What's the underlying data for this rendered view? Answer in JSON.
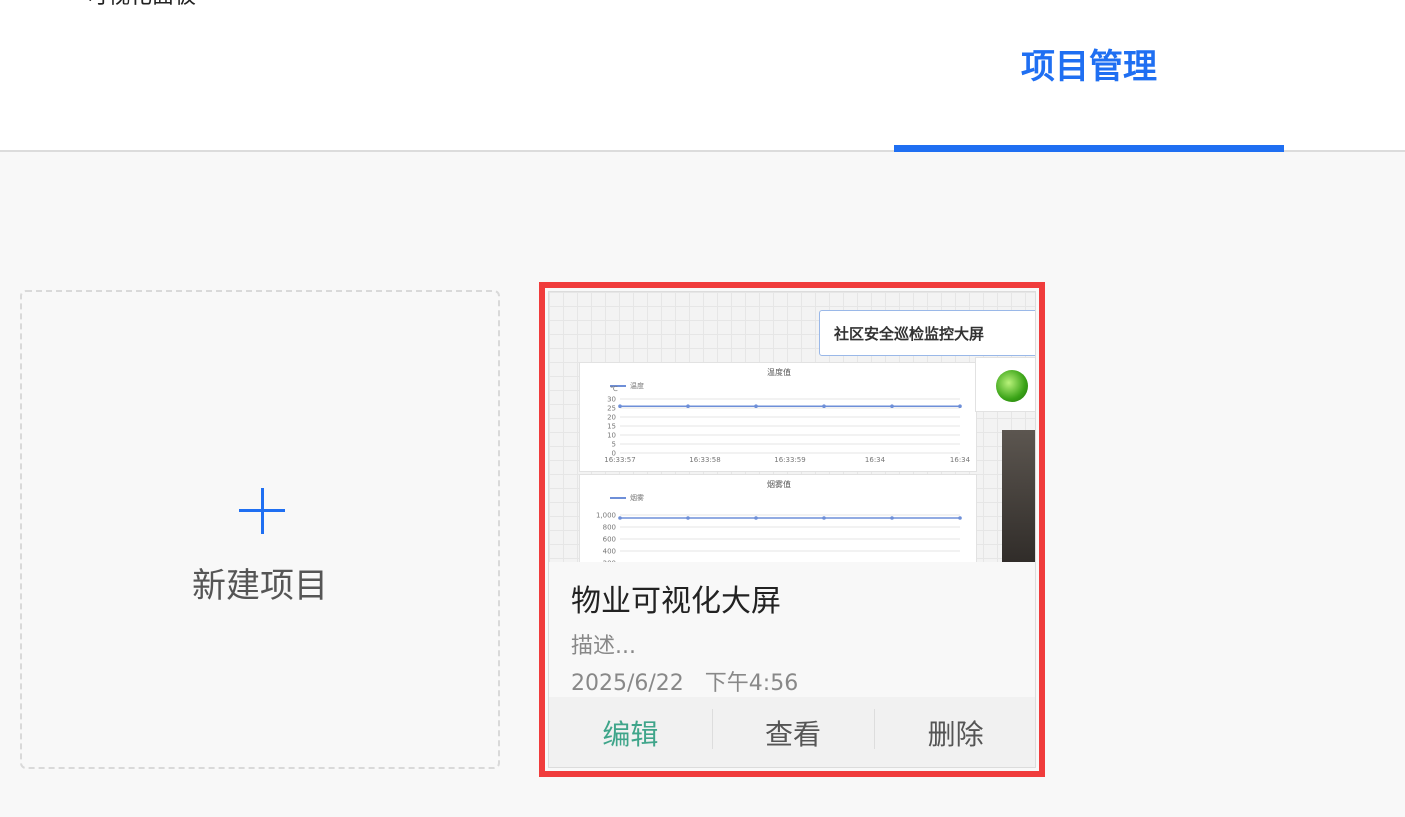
{
  "header": {
    "app_title": "可视化面板",
    "active_tab": "项目管理"
  },
  "new_project": {
    "label": "新建项目",
    "icon": "plus-icon"
  },
  "project": {
    "name": "物业可视化大屏",
    "description": "描述...",
    "date": "2025/6/22",
    "time": "下午4:56",
    "thumbnail": {
      "banner": "社区安全巡检监控大屏",
      "temperature_chart": {
        "title": "温度值",
        "legend": "温度",
        "unit": "℃",
        "y_ticks": [
          "30",
          "25",
          "20",
          "15",
          "10",
          "5",
          "0"
        ],
        "x_ticks": [
          "16:33:57",
          "16:33:58",
          "16:33:59",
          "16:34",
          "16:34"
        ]
      },
      "smoke_chart": {
        "title": "烟雾值",
        "legend": "烟雾",
        "y_ticks": [
          "1,000",
          "800",
          "600",
          "400",
          "200"
        ]
      }
    },
    "actions": {
      "edit": "编辑",
      "view": "查看",
      "delete": "删除"
    }
  },
  "chart_data": [
    {
      "type": "line",
      "title": "温度值",
      "ylabel": "℃",
      "x": [
        "16:33:57",
        "16:33:58",
        "16:33:59",
        "16:34",
        "16:34"
      ],
      "series": [
        {
          "name": "温度",
          "values": [
            26,
            26,
            26,
            26,
            26,
            26
          ]
        }
      ],
      "ylim": [
        0,
        30
      ]
    },
    {
      "type": "line",
      "title": "烟雾值",
      "series": [
        {
          "name": "烟雾",
          "values": [
            950,
            950,
            950,
            950,
            950,
            950
          ]
        }
      ],
      "ylim": [
        0,
        1000
      ]
    }
  ],
  "colors": {
    "accent": "#1f6ff2",
    "highlight_border": "#f03c3c",
    "edit": "#3fa58a",
    "series_line": "#6e8fd8"
  }
}
